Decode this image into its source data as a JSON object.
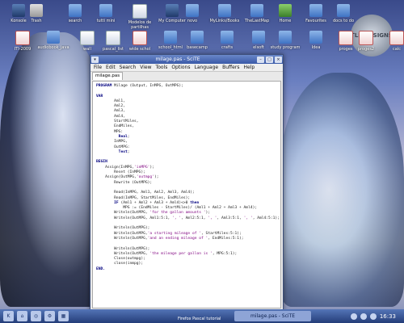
{
  "desktop": {
    "icons": [
      {
        "label": "Konsole",
        "type": "monitor"
      },
      {
        "label": "Trash",
        "type": "trash"
      },
      {
        "label": "search",
        "type": "folder"
      },
      {
        "label": "tutti mini",
        "type": "folder"
      },
      {
        "label": "Modelos de partilhas",
        "type": "doc"
      },
      {
        "label": "My Computer",
        "type": "monitor"
      },
      {
        "label": "novo",
        "type": "folder"
      },
      {
        "label": "MyLinks/Books",
        "type": "folder"
      },
      {
        "label": "TheLastMap",
        "type": "folder"
      },
      {
        "label": "Home",
        "type": "home"
      },
      {
        "label": "Favourites",
        "type": "folder"
      },
      {
        "label": "docs to do",
        "type": "folder"
      },
      {
        "label": "ITI-2009",
        "type": "pdf"
      },
      {
        "label": "audiobook_java",
        "type": "folder"
      },
      {
        "label": "wall",
        "type": "doc"
      },
      {
        "label": "pascal_list",
        "type": "doc"
      },
      {
        "label": "wide schol",
        "type": "pdf"
      },
      {
        "label": "school_html",
        "type": "folder"
      },
      {
        "label": "basecamp",
        "type": "folder"
      },
      {
        "label": "crafts",
        "type": "folder"
      },
      {
        "label": "elsoft",
        "type": "folder"
      },
      {
        "label": "study program",
        "type": "folder"
      },
      {
        "label": "Idea",
        "type": "folder"
      },
      {
        "label": "proges",
        "type": "pdf"
      },
      {
        "label": "proges2",
        "type": "pdf"
      },
      {
        "label": "calc",
        "type": "pdf"
      }
    ],
    "logo_text": "TLB DESIGNS"
  },
  "window": {
    "title": "milage.pas - SciTE",
    "menu": [
      "File",
      "Edit",
      "Search",
      "View",
      "Tools",
      "Options",
      "Language",
      "Buffers",
      "Help"
    ],
    "tab": "milage.pas",
    "code": [
      "PROGRAM Milage (Output, InMPG, OutMPG);",
      "",
      "VAR",
      "        Aml1,",
      "        Aml2,",
      "        Aml3,",
      "        Aml4,",
      "        StartMiles,",
      "        EndMiles,",
      "        MPG:",
      "          Real;",
      "        InMPG,",
      "        OutMPG:",
      "          Text;",
      "",
      "BEGIN",
      "    Assign(InMPG,'inMPG');",
      "        Reset (InMPG);",
      "    Assign(OutMPG,'outmpg');",
      "        Rewrite (OutMPG);",
      "",
      "        Read(InMPG, Aml1, Aml2, Aml3, Aml4);",
      "        Read(InMPG, StartMiles, EndMiles);",
      "        IF (Aml1 + Aml2 + Aml3 + Aml4)<>0 then",
      "            MPG := (EndMiles - StartMiles)/ (Aml1 + Aml2 + Aml3 + Aml4);",
      "        Writeln(OutMPG, 'for the gallon amounts ');",
      "        Writeln(OutMPG, Aml1:5:1, ', ', Aml2:5:1, ', ', Aml3:5:1, ', ', Aml4:5:1);",
      "",
      "        Writeln(OutMPG);",
      "        Writeln(OutMPG,'a starting mileage of ', StartMiles:5:1);",
      "        Writeln(OutMPG,'and an ending mileage of ', EndMiles:5:1);",
      "",
      "        Writeln(OutMPG);",
      "        Writeln(OutMPG, 'the mileage per gallon is ', MPG:5:1);",
      "        Close(outmpg);",
      "        close(inmpg);",
      "END."
    ]
  },
  "taskbar": {
    "task_label": "milage.pas - SciTE",
    "task_sub": "Firefox Pascal tutorial",
    "clock": "16:33"
  }
}
